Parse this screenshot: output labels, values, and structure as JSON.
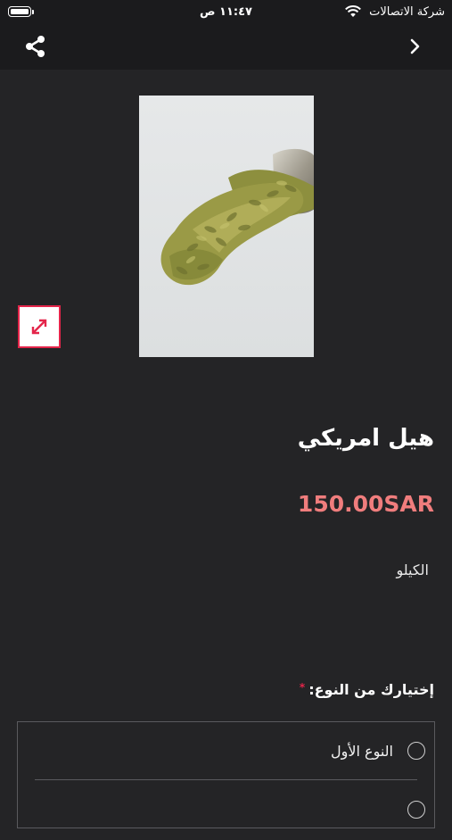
{
  "status_bar": {
    "carrier": "شركة الاتصالات",
    "time": "١١:٤٧ ص"
  },
  "navbar": {
    "share_icon": "share-icon",
    "back_icon": "chevron-right-icon"
  },
  "product": {
    "image_icon": "expand-icon",
    "name": "هيل امريكي",
    "price": "150.00SAR",
    "unit": "الكيلو"
  },
  "options": {
    "label": "إختيارك من النوع:",
    "required_mark": "*",
    "items": [
      {
        "label": "النوع الأول",
        "selected": false
      },
      {
        "label": "",
        "selected": false
      }
    ]
  },
  "colors": {
    "background": "#242426",
    "bar": "#1b1b1d",
    "price": "#f07d7d",
    "accent": "#e4254a"
  }
}
